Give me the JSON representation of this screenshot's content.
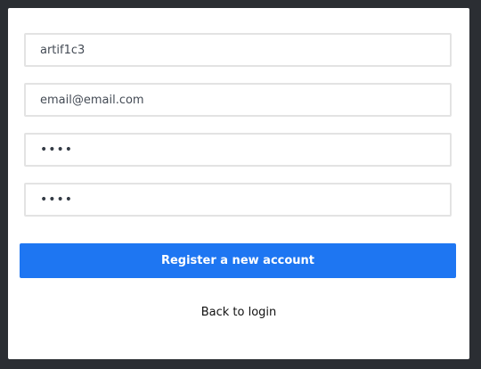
{
  "form": {
    "username_value": "artif1c3",
    "email_value": "email@email.com",
    "password_value": "••••",
    "confirm_password_value": "••••"
  },
  "actions": {
    "register_label": "Register a new account",
    "back_label": "Back to login"
  },
  "colors": {
    "background": "#2b2e33",
    "card": "#ffffff",
    "accent": "#1e76f2"
  }
}
